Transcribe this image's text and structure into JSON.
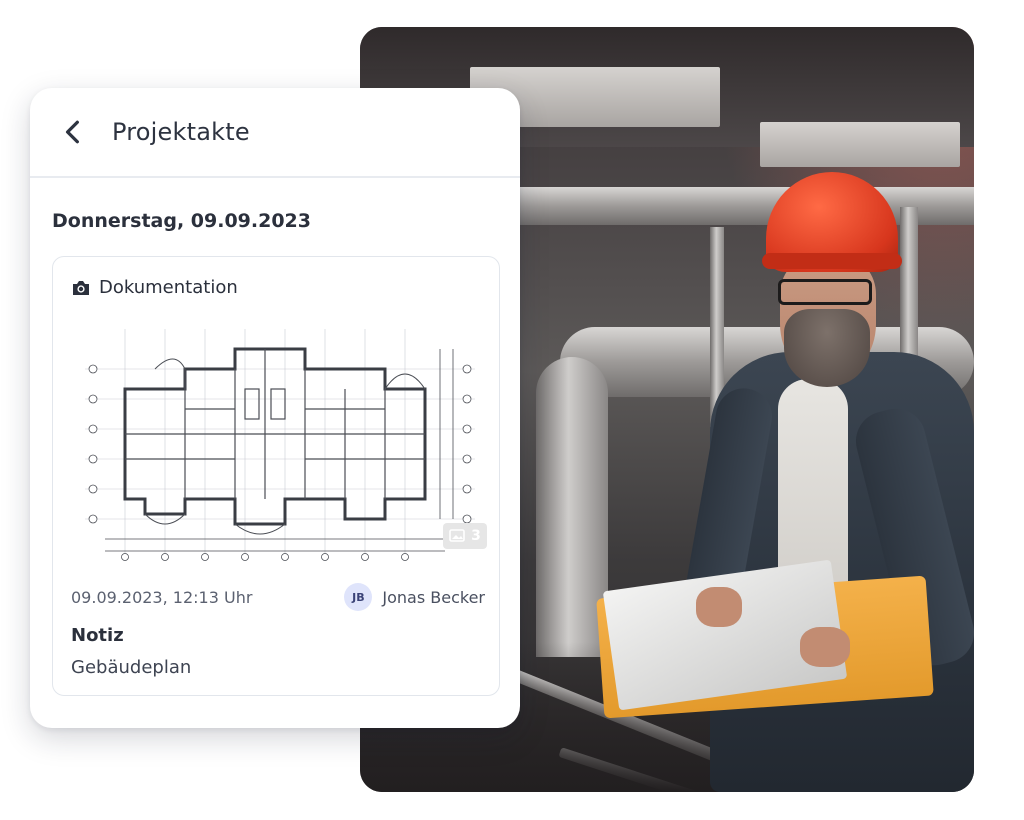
{
  "header": {
    "title": "Projektakte",
    "back_icon": "chevron-left-icon"
  },
  "date_heading": "Donnerstag, 09.09.2023",
  "entry": {
    "type_icon": "camera-icon",
    "type_label": "Dokumentation",
    "image_count": "3",
    "image_count_icon": "images-icon",
    "timestamp": "09.09.2023, 12:13 Uhr",
    "author": {
      "initials": "JB",
      "name": "Jonas Becker"
    },
    "note_label": "Notiz",
    "note_text": "Gebäudeplan"
  },
  "colors": {
    "card_bg": "#ffffff",
    "text_dark": "#2b303c",
    "avatar_bg": "#dfe4fb",
    "helmet": "#d7361d",
    "folder": "#f4b14a"
  }
}
